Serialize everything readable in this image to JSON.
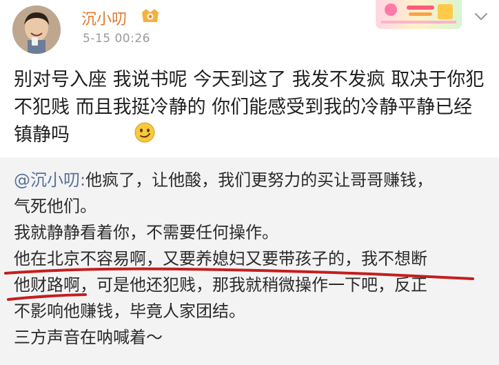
{
  "post": {
    "author": "沉小叨",
    "timestamp": "5-15 00:26",
    "text": "别对号入座 我说书呢 今天到这了 我发不发疯 取决于你犯不犯贱 而且我挺冷静的 你们能感受到我的冷静平静已经镇静吗",
    "emoji": "smirk-emoji"
  },
  "repost": {
    "mention": "@沉小叨:",
    "line1": "他疯了，让他酸，我们更努力的买让哥哥赚钱，",
    "line2": "气死他们。",
    "line3": "我就静静看着你，不需要任何操作。",
    "line4": "他在北京不容易啊，又要养媳妇又要带孩子的，我不想断",
    "line5": "他财路啊，可是他还犯贱，那我就稍微操作一下吧，反正",
    "line6": "不影响他赚钱，毕竟人家团结。",
    "line7": "三方声音在呐喊着～"
  },
  "colors": {
    "username": "#e07a2e",
    "mention": "#5a6f96",
    "repost_bg": "#f3f3f4",
    "underline": "#c41e1e"
  }
}
